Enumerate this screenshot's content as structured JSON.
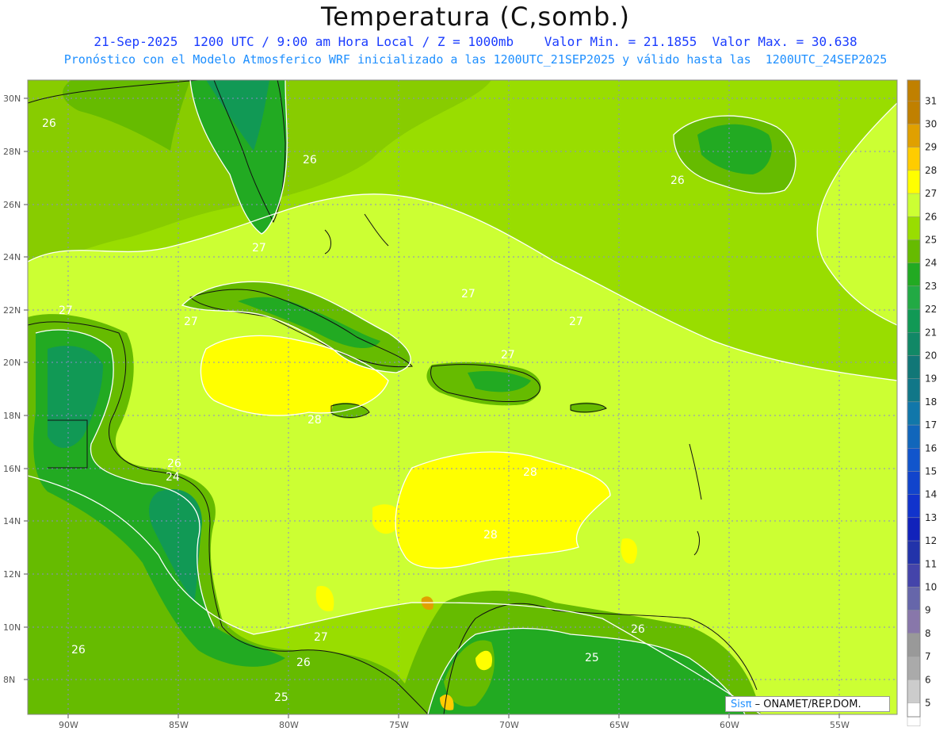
{
  "header": {
    "title": "Temperatura (C,somb.)",
    "line1": "21-Sep-2025  1200 UTC / 9:00 am Hora Local / Z = 1000mb    Valor Min. = 21.1855  Valor Max. = 30.638",
    "line2": "Pronóstico con el Modelo Atmosferico WRF inicializado a las 1200UTC_21SEP2025 y válido hasta las  1200UTC_24SEP2025"
  },
  "axes": {
    "lat_labels": [
      "30N",
      "28N",
      "26N",
      "24N",
      "22N",
      "20N",
      "18N",
      "16N",
      "14N",
      "12N",
      "10N",
      "8N"
    ],
    "lon_labels": [
      "90W",
      "85W",
      "80W",
      "75W",
      "70W",
      "65W",
      "60W",
      "55W"
    ]
  },
  "contour_labels": [
    "26",
    "26",
    "26",
    "27",
    "27",
    "27",
    "27",
    "27",
    "27",
    "28",
    "26",
    "24",
    "28",
    "28",
    "27",
    "26",
    "25",
    "26",
    "25",
    "26"
  ],
  "colorbar": {
    "levels": [
      "31",
      "30",
      "29",
      "28",
      "27",
      "26",
      "25",
      "24",
      "23",
      "22",
      "21",
      "20",
      "19",
      "18",
      "17",
      "16",
      "15",
      "14",
      "13",
      "12",
      "11",
      "10",
      "9",
      "8",
      "7",
      "6",
      "5"
    ],
    "colors": [
      "#c08000",
      "#e0a000",
      "#ffcc00",
      "#ffff00",
      "#ccff33",
      "#99dd00",
      "#66bb00",
      "#22aa22",
      "#22aa44",
      "#119955",
      "#118866",
      "#117777",
      "#117788",
      "#1177aa",
      "#1166bb",
      "#1155cc",
      "#1144cc",
      "#1133cc",
      "#1122bb",
      "#2233aa",
      "#4444aa",
      "#6666aa",
      "#8877aa",
      "#999999",
      "#aaaaaa",
      "#cccccc",
      "#ffffff"
    ]
  },
  "credit": {
    "sis": "Sisπ",
    "org": " – ONAMET/REP.DOM."
  }
}
